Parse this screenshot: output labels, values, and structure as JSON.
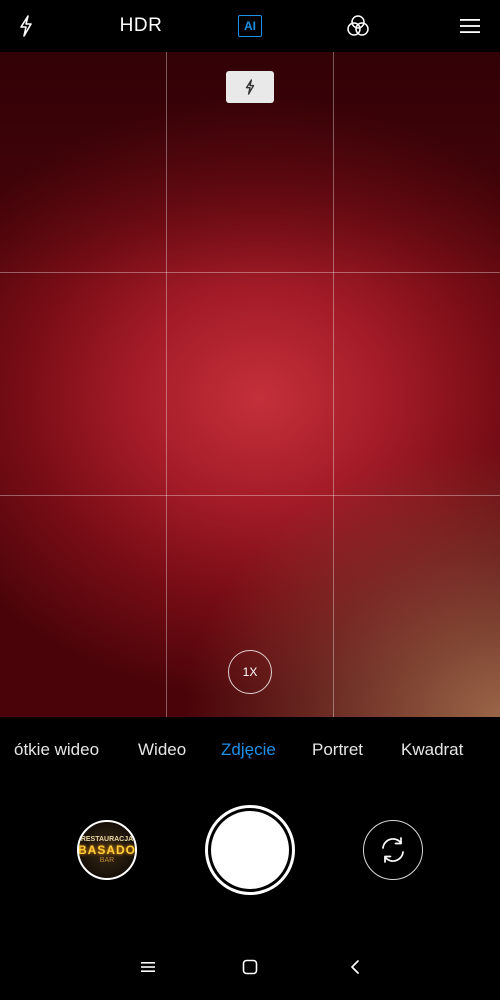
{
  "topbar": {
    "flash_icon": "lightning-icon",
    "hdr_label": "HDR",
    "ai_label": "AI",
    "filters_icon": "filters-icon",
    "menu_icon": "hamburger-menu-icon",
    "ai_color": "#1e8fe6"
  },
  "viewfinder": {
    "flash_indicator_icon": "lightning-icon",
    "zoom_label": "1X"
  },
  "modes": {
    "items": [
      {
        "label": "ótkie wideo"
      },
      {
        "label": "Wideo"
      },
      {
        "label": "Zdjęcie"
      },
      {
        "label": "Portret"
      },
      {
        "label": "Kwadrat"
      }
    ],
    "active_index": 2,
    "active_color": "#1e8fe6"
  },
  "gallery_thumbnail": {
    "line1": "RESTAURACJA",
    "line2": "BASADO",
    "line3": "BAR"
  },
  "controls": {
    "shutter_icon": "shutter-icon",
    "switch_camera_icon": "switch-camera-icon"
  },
  "navbar": {
    "recents_icon": "recents-icon",
    "home_icon": "home-icon",
    "back_icon": "back-icon"
  }
}
